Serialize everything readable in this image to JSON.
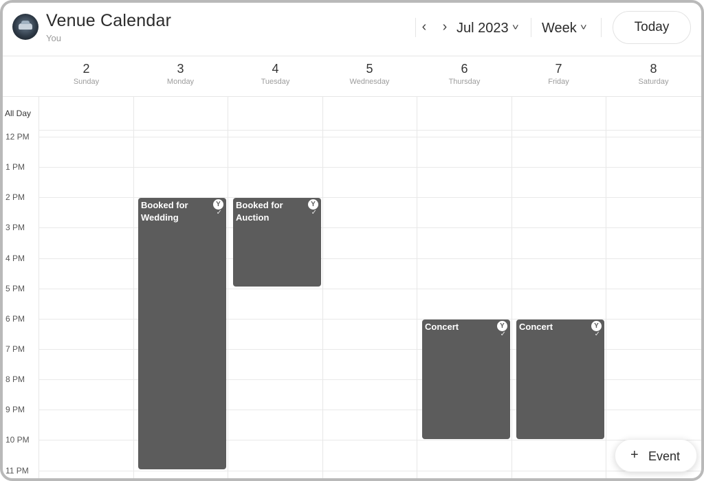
{
  "header": {
    "title": "Venue Calendar",
    "subtitle": "You",
    "prev_icon": "‹",
    "next_icon": "›",
    "month_label": "Jul 2023",
    "view_label": "Week",
    "today_label": "Today"
  },
  "days": [
    {
      "num": "2",
      "name": "Sunday"
    },
    {
      "num": "3",
      "name": "Monday"
    },
    {
      "num": "4",
      "name": "Tuesday"
    },
    {
      "num": "5",
      "name": "Wednesday"
    },
    {
      "num": "6",
      "name": "Thursday"
    },
    {
      "num": "7",
      "name": "Friday"
    },
    {
      "num": "8",
      "name": "Saturday"
    }
  ],
  "all_day_label": "All Day",
  "hours": [
    "12 PM",
    "1 PM",
    "2 PM",
    "3 PM",
    "4 PM",
    "5 PM",
    "6 PM",
    "7 PM",
    "8 PM",
    "9 PM",
    "10 PM",
    "11 PM"
  ],
  "events": [
    {
      "title": "Booked for Wedding",
      "day": "3",
      "start": "2 PM",
      "end": "11 PM",
      "badge": "Y",
      "status": "confirmed"
    },
    {
      "title": "Booked for Auction",
      "day": "4",
      "start": "2 PM",
      "end": "5 PM",
      "badge": "Y",
      "status": "confirmed"
    },
    {
      "title": "Concert",
      "day": "6",
      "start": "6 PM",
      "end": "10 PM",
      "badge": "Y",
      "status": "confirmed"
    },
    {
      "title": "Concert",
      "day": "7",
      "start": "6 PM",
      "end": "10 PM",
      "badge": "Y",
      "status": "confirmed"
    }
  ],
  "event_colors": {
    "fill": "#5c5c5c",
    "text": "#ffffff"
  },
  "fab": {
    "icon": "+",
    "label": "Event"
  }
}
